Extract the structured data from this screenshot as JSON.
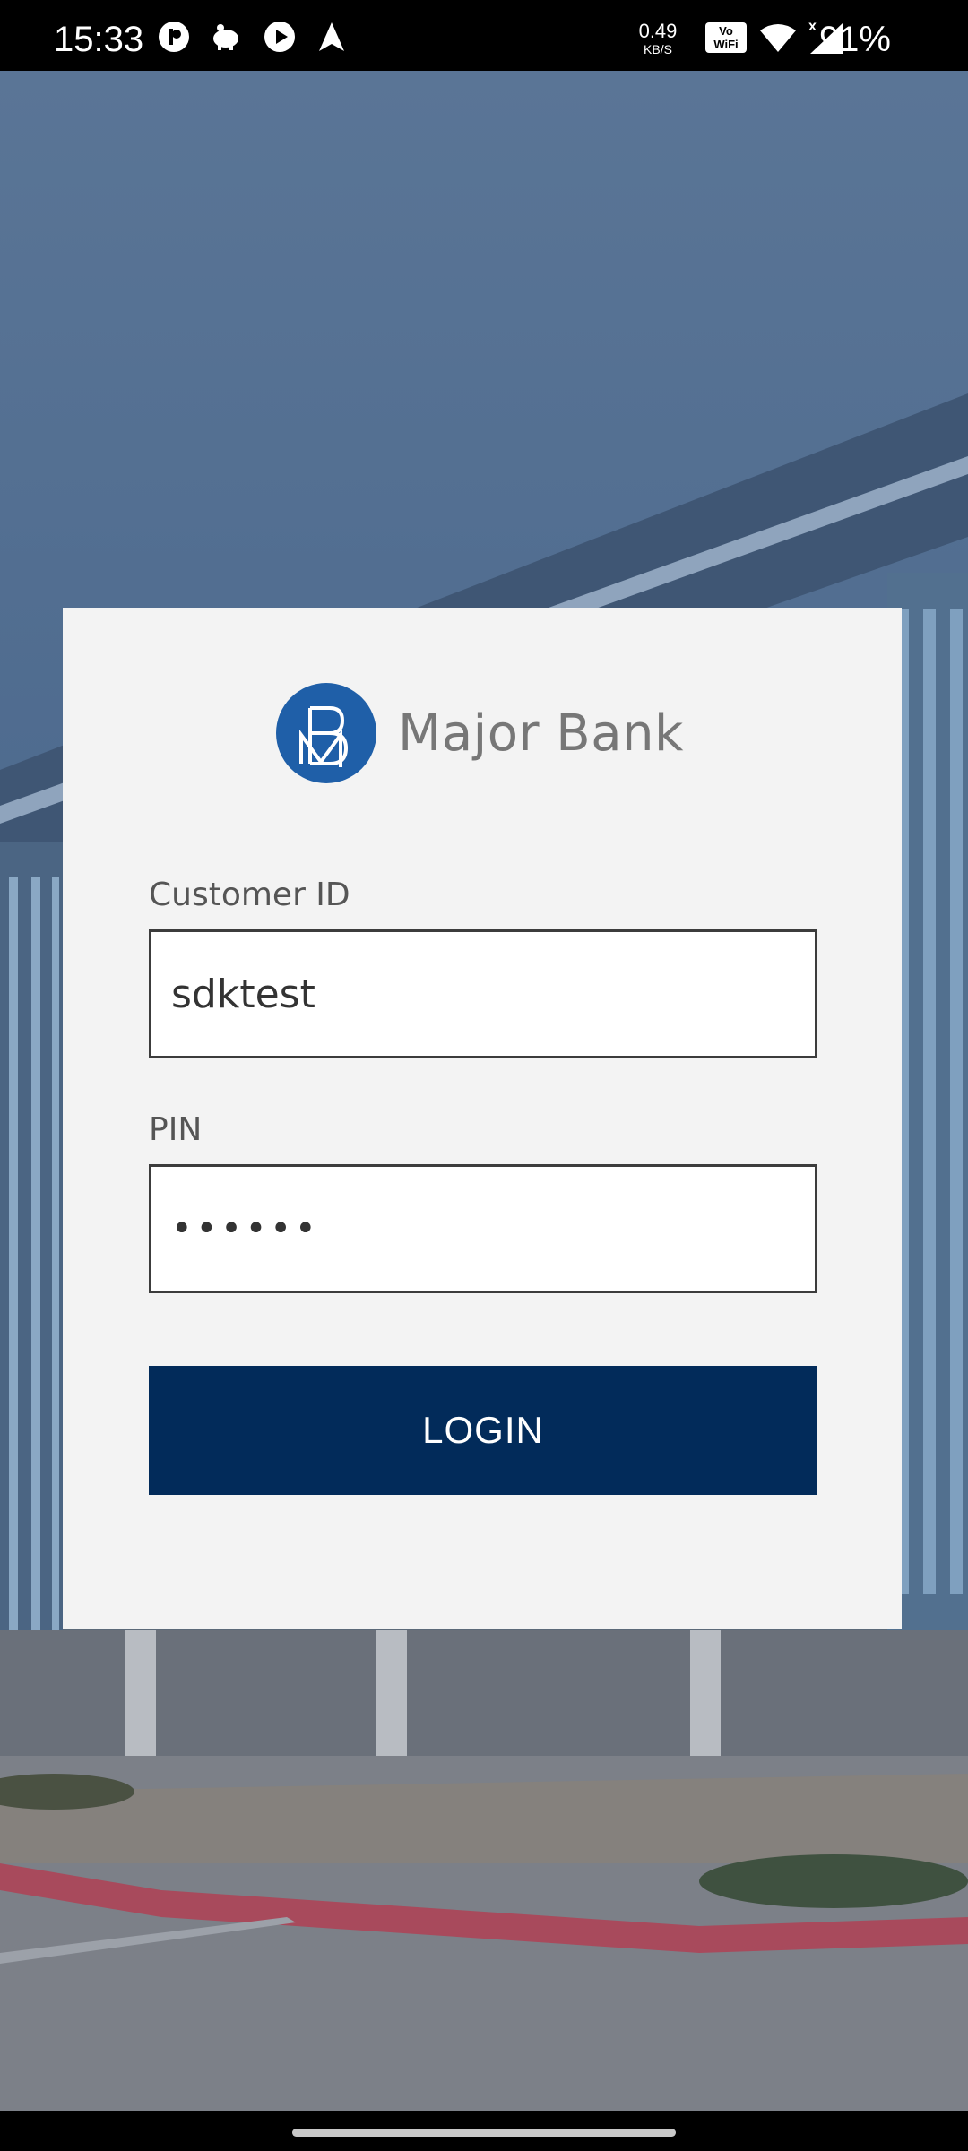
{
  "status_bar": {
    "time": "15:33",
    "net_speed_value": "0.49",
    "net_speed_unit": "KB/S",
    "battery": "91%",
    "icons": [
      "app-indicator-icon",
      "piggy-bank-icon",
      "play-icon",
      "navigation-arrow-icon",
      "vowifi-icon",
      "wifi-icon",
      "cellular-signal-icon"
    ]
  },
  "login": {
    "brand_name": "Major Bank",
    "customer_id_label": "Customer ID",
    "customer_id_value": "sdktest",
    "pin_label": "PIN",
    "pin_value": "••••••",
    "login_button": "LOGIN"
  },
  "colors": {
    "primary": "#022b5a",
    "logo_blue": "#1f5fa8",
    "card_bg": "#f3f3f3"
  }
}
